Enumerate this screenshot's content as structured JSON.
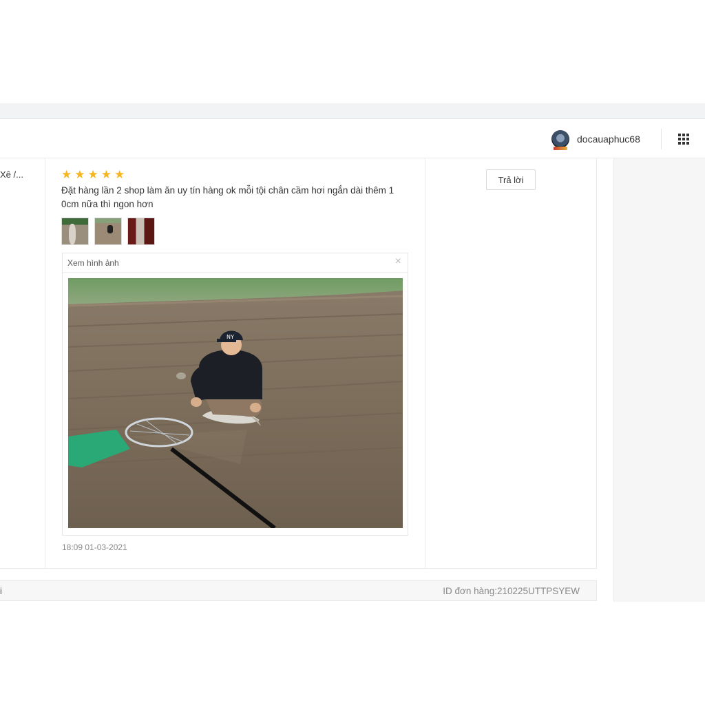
{
  "header": {
    "username": "docauaphuc68",
    "avatar_icon": "shop-avatar-icon",
    "apps_icon": "grid-apps-icon"
  },
  "review": {
    "product_truncated": "Xê /...",
    "rating": 5,
    "comment": "Đặt hàng lần 2 shop làm ăn uy tín hàng ok mỗi tội chân cầm hơi ngắn dài thêm 1 0cm nữa thì ngon hơn",
    "thumbnails": [
      "photo-1",
      "photo-2",
      "photo-3"
    ],
    "viewer_title": "Xem hình ảnh",
    "close_symbol": "×",
    "timestamp": "18:09 01-03-2021",
    "reply_label": "Trả lời"
  },
  "order": {
    "left_fragment": "i",
    "order_id": "ID đơn hàng:210225UTTPSYEW"
  },
  "colors": {
    "star": "#f6b51e",
    "background_band": "#f2f3f5"
  }
}
